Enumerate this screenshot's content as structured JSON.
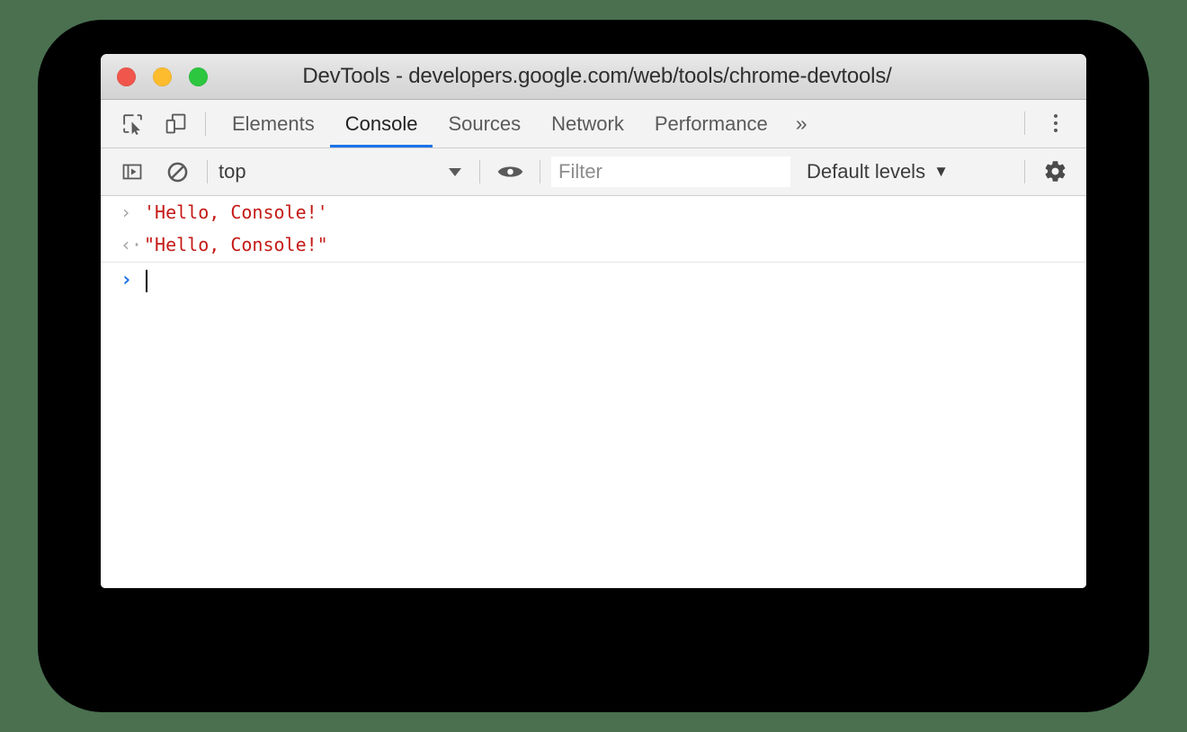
{
  "window": {
    "title": "DevTools - developers.google.com/web/tools/chrome-devtools/",
    "traffic_lights": {
      "close": "close-button",
      "minimize": "minimize-button",
      "maximize": "maximize-button"
    }
  },
  "theme": {
    "page_background": "#4a7050",
    "bezel": "#000000",
    "accent_blue": "#1a73e8",
    "string_red": "#c41a16",
    "toolbar_bg": "#f3f3f3",
    "titlebar_bg": "#dcdcdc",
    "traffic_red": "#f0564b",
    "traffic_yellow": "#fdbc2d",
    "traffic_green": "#2cc63f"
  },
  "panel_tabbar": {
    "inspect_icon": "inspect-element-icon",
    "device_icon": "device-toolbar-icon",
    "tabs": [
      {
        "label": "Elements",
        "active": false
      },
      {
        "label": "Console",
        "active": true
      },
      {
        "label": "Sources",
        "active": false
      },
      {
        "label": "Network",
        "active": false
      },
      {
        "label": "Performance",
        "active": false
      }
    ],
    "overflow_label": "»",
    "more_menu_icon": "kebab-menu-icon"
  },
  "console_toolbar": {
    "sidebar_toggle_icon": "console-sidebar-toggle-icon",
    "clear_icon": "clear-console-icon",
    "context": {
      "value": "top",
      "caret": "chevron-down-icon"
    },
    "live_expression_icon": "eye-icon",
    "filter": {
      "value": "",
      "placeholder": "Filter"
    },
    "levels": {
      "value": "Default levels",
      "caret": "▼"
    },
    "settings_icon": "gear-icon"
  },
  "console_body": {
    "rows": [
      {
        "kind": "input",
        "marker": "›",
        "text": "'Hello, Console!'"
      },
      {
        "kind": "output",
        "marker": "‹·",
        "text": "\"Hello, Console!\""
      }
    ],
    "prompt": {
      "marker": "›",
      "value": ""
    }
  }
}
